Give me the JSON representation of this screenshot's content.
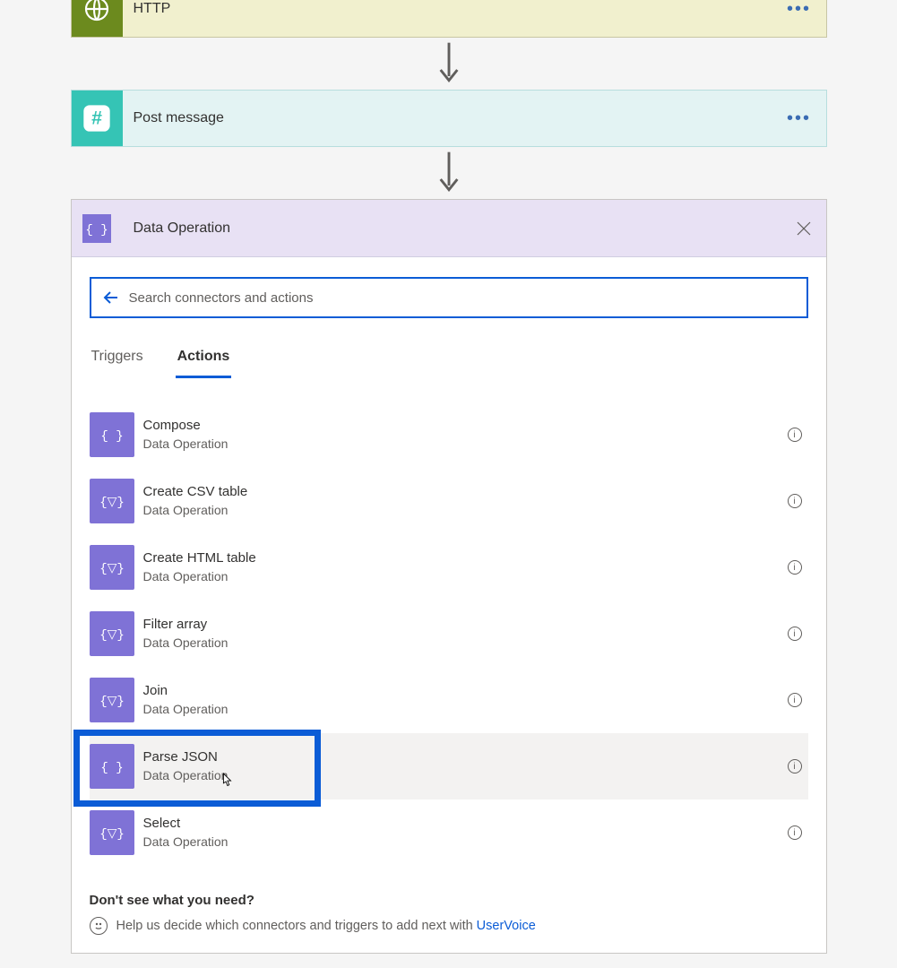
{
  "steps": {
    "http": {
      "title": "HTTP"
    },
    "post": {
      "title": "Post message"
    }
  },
  "picker": {
    "title": "Data Operation",
    "search_placeholder": "Search connectors and actions",
    "tabs": {
      "triggers": "Triggers",
      "actions": "Actions"
    },
    "actions": [
      {
        "name": "Compose",
        "sub": "Data Operation"
      },
      {
        "name": "Create CSV table",
        "sub": "Data Operation"
      },
      {
        "name": "Create HTML table",
        "sub": "Data Operation"
      },
      {
        "name": "Filter array",
        "sub": "Data Operation"
      },
      {
        "name": "Join",
        "sub": "Data Operation"
      },
      {
        "name": "Parse JSON",
        "sub": "Data Operation"
      },
      {
        "name": "Select",
        "sub": "Data Operation"
      }
    ],
    "footer": {
      "heading": "Don't see what you need?",
      "text": "Help us decide which connectors and triggers to add next with",
      "link": "UserVoice"
    }
  }
}
